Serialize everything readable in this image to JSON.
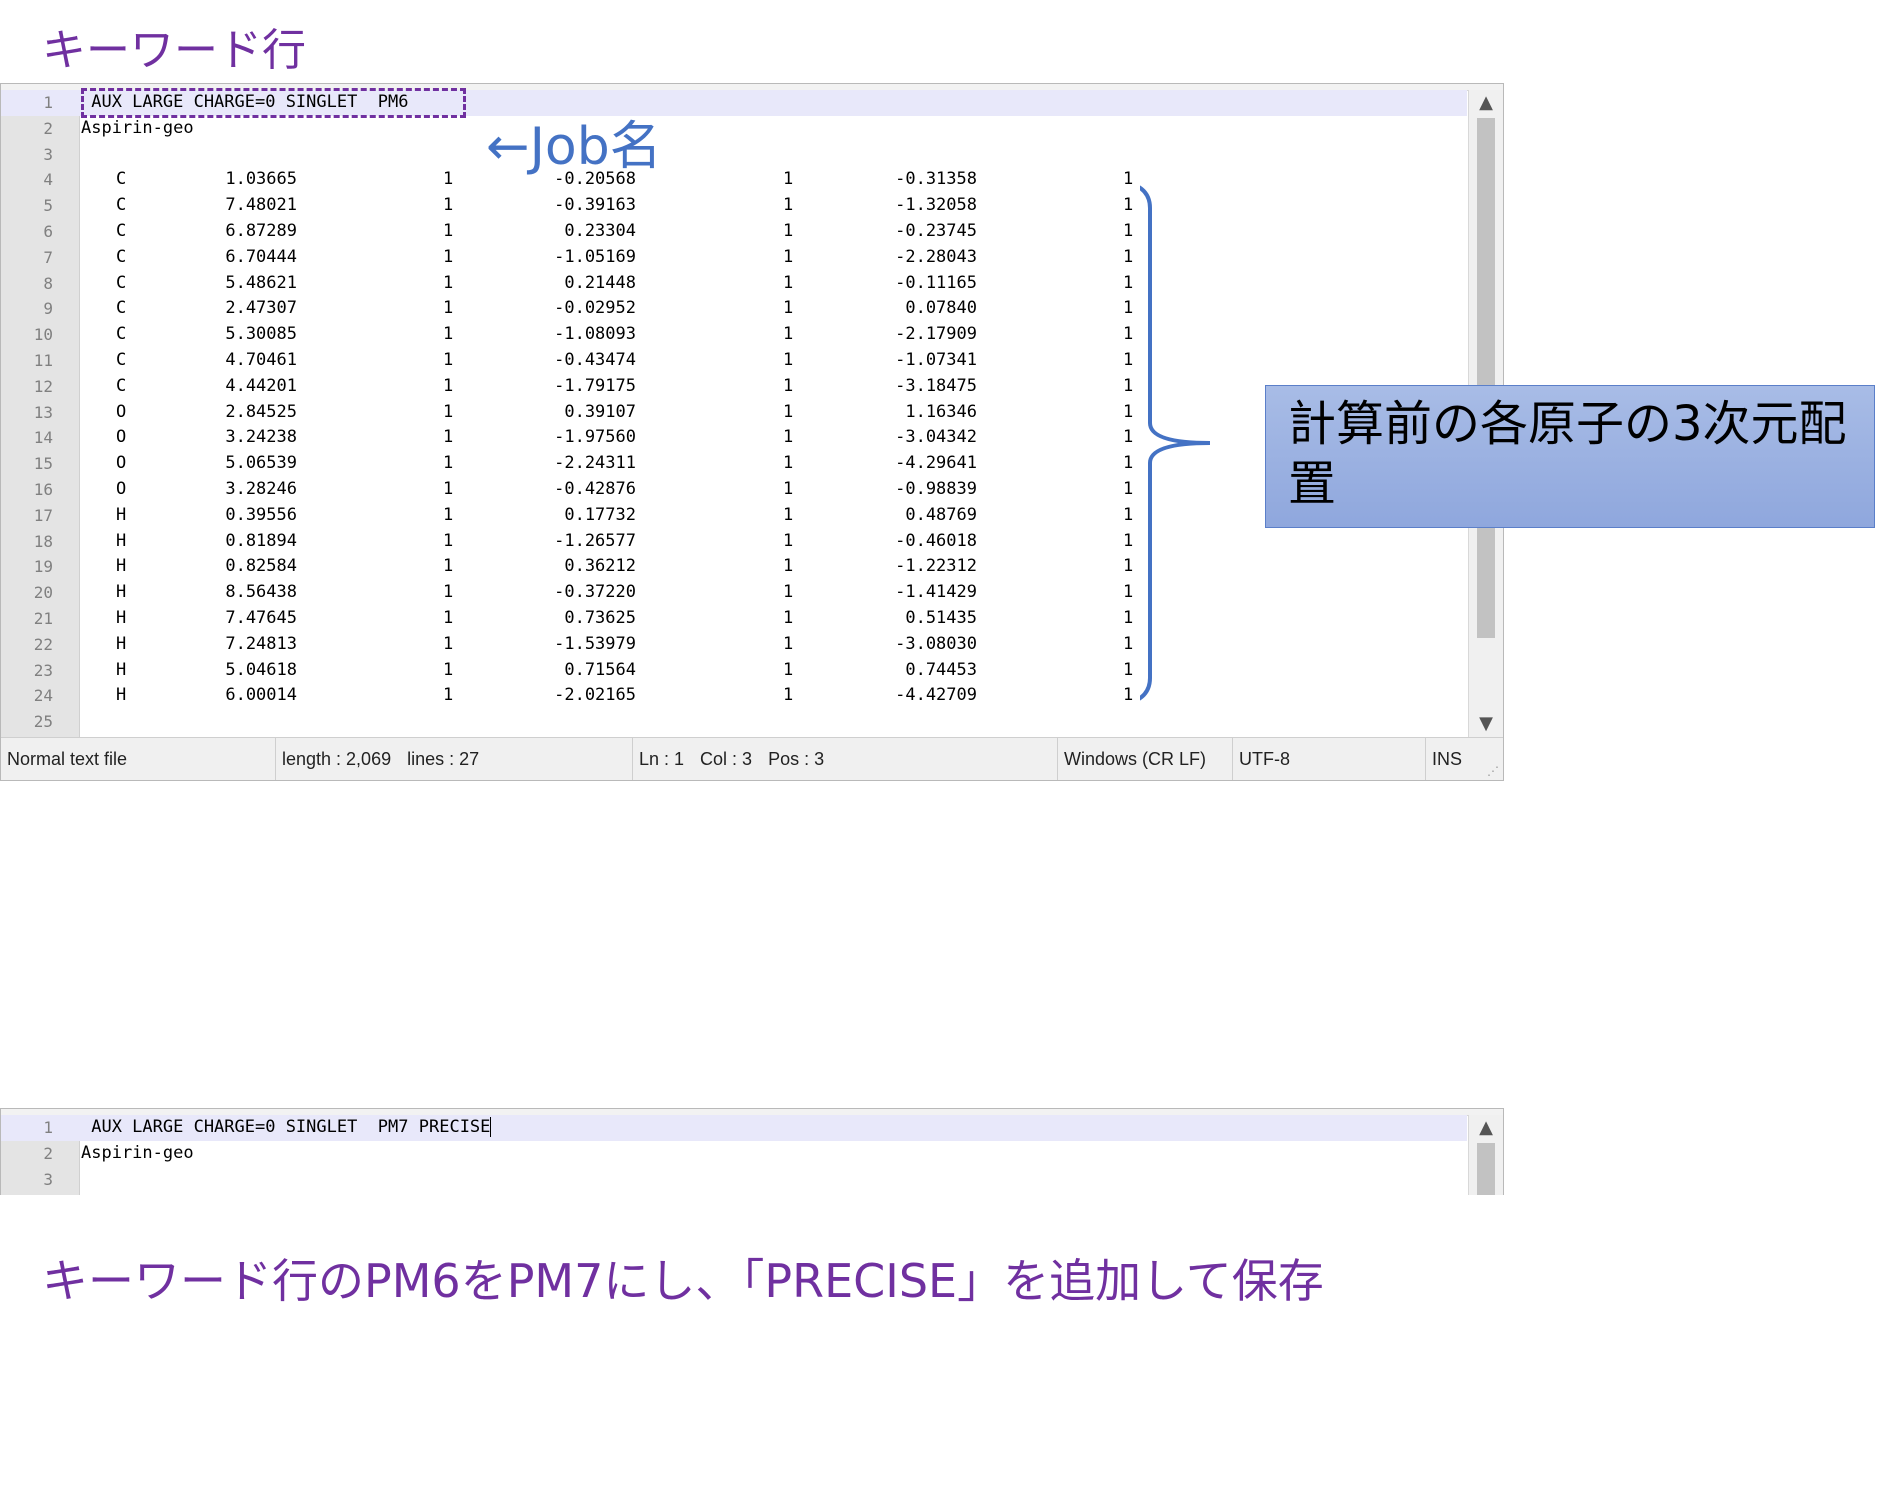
{
  "annotations": {
    "title_top": "キーワード行",
    "job_label": "←Job名",
    "callout": "計算前の各原子の3次元配置",
    "caption_bottom": "キーワード行のPM6をPM7にし、「PRECISE」を追加して保存"
  },
  "colors": {
    "annotation_purple": "#7030a0",
    "annotation_blue": "#4472c4",
    "callout_fill": "#9fb4e3"
  },
  "editor_top": {
    "line1": " AUX LARGE CHARGE=0 SINGLET  PM6",
    "line2": "Aspirin-geo",
    "line3": "",
    "line_numbers": [
      "1",
      "2",
      "3",
      "4",
      "5",
      "6",
      "7",
      "8",
      "9",
      "10",
      "11",
      "12",
      "13",
      "14",
      "15",
      "16",
      "17",
      "18",
      "19",
      "20",
      "21",
      "22",
      "23",
      "24",
      "25"
    ],
    "atoms": [
      {
        "el": "C",
        "x": "1.03665",
        "f1": "1",
        "y": "-0.20568",
        "f2": "1",
        "z": "-0.31358",
        "f3": "1"
      },
      {
        "el": "C",
        "x": "7.48021",
        "f1": "1",
        "y": "-0.39163",
        "f2": "1",
        "z": "-1.32058",
        "f3": "1"
      },
      {
        "el": "C",
        "x": "6.87289",
        "f1": "1",
        "y": "0.23304",
        "f2": "1",
        "z": "-0.23745",
        "f3": "1"
      },
      {
        "el": "C",
        "x": "6.70444",
        "f1": "1",
        "y": "-1.05169",
        "f2": "1",
        "z": "-2.28043",
        "f3": "1"
      },
      {
        "el": "C",
        "x": "5.48621",
        "f1": "1",
        "y": "0.21448",
        "f2": "1",
        "z": "-0.11165",
        "f3": "1"
      },
      {
        "el": "C",
        "x": "2.47307",
        "f1": "1",
        "y": "-0.02952",
        "f2": "1",
        "z": "0.07840",
        "f3": "1"
      },
      {
        "el": "C",
        "x": "5.30085",
        "f1": "1",
        "y": "-1.08093",
        "f2": "1",
        "z": "-2.17909",
        "f3": "1"
      },
      {
        "el": "C",
        "x": "4.70461",
        "f1": "1",
        "y": "-0.43474",
        "f2": "1",
        "z": "-1.07341",
        "f3": "1"
      },
      {
        "el": "C",
        "x": "4.44201",
        "f1": "1",
        "y": "-1.79175",
        "f2": "1",
        "z": "-3.18475",
        "f3": "1"
      },
      {
        "el": "O",
        "x": "2.84525",
        "f1": "1",
        "y": "0.39107",
        "f2": "1",
        "z": "1.16346",
        "f3": "1"
      },
      {
        "el": "O",
        "x": "3.24238",
        "f1": "1",
        "y": "-1.97560",
        "f2": "1",
        "z": "-3.04342",
        "f3": "1"
      },
      {
        "el": "O",
        "x": "5.06539",
        "f1": "1",
        "y": "-2.24311",
        "f2": "1",
        "z": "-4.29641",
        "f3": "1"
      },
      {
        "el": "O",
        "x": "3.28246",
        "f1": "1",
        "y": "-0.42876",
        "f2": "1",
        "z": "-0.98839",
        "f3": "1"
      },
      {
        "el": "H",
        "x": "0.39556",
        "f1": "1",
        "y": "0.17732",
        "f2": "1",
        "z": "0.48769",
        "f3": "1"
      },
      {
        "el": "H",
        "x": "0.81894",
        "f1": "1",
        "y": "-1.26577",
        "f2": "1",
        "z": "-0.46018",
        "f3": "1"
      },
      {
        "el": "H",
        "x": "0.82584",
        "f1": "1",
        "y": "0.36212",
        "f2": "1",
        "z": "-1.22312",
        "f3": "1"
      },
      {
        "el": "H",
        "x": "8.56438",
        "f1": "1",
        "y": "-0.37220",
        "f2": "1",
        "z": "-1.41429",
        "f3": "1"
      },
      {
        "el": "H",
        "x": "7.47645",
        "f1": "1",
        "y": "0.73625",
        "f2": "1",
        "z": "0.51435",
        "f3": "1"
      },
      {
        "el": "H",
        "x": "7.24813",
        "f1": "1",
        "y": "-1.53979",
        "f2": "1",
        "z": "-3.08030",
        "f3": "1"
      },
      {
        "el": "H",
        "x": "5.04618",
        "f1": "1",
        "y": "0.71564",
        "f2": "1",
        "z": "0.74453",
        "f3": "1"
      },
      {
        "el": "H",
        "x": "6.00014",
        "f1": "1",
        "y": "-2.02165",
        "f2": "1",
        "z": "-4.42709",
        "f3": "1"
      }
    ],
    "status": {
      "file_type": "Normal text file",
      "length": "length : 2,069",
      "lines": "lines : 27",
      "ln": "Ln : 1",
      "col": "Col : 3",
      "pos": "Pos : 3",
      "eol": "Windows (CR LF)",
      "encoding": "UTF-8",
      "mode": "INS"
    }
  },
  "editor_bottom": {
    "line1": " AUX LARGE CHARGE=0 SINGLET  PM7 PRECISE",
    "line2": "Aspirin-geo",
    "line_numbers": [
      "1",
      "2",
      "3"
    ]
  },
  "icons": {
    "scroll_up": "▲",
    "scroll_down": "▼",
    "resize_grip": "⋰"
  }
}
